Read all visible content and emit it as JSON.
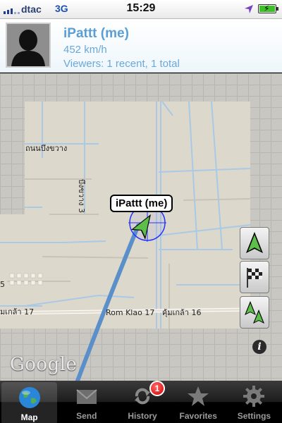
{
  "status_bar": {
    "carrier": "dtac",
    "network": "3G",
    "time": "15:29",
    "icons": [
      "signal-icon",
      "location-arrow-icon",
      "battery-charging-icon"
    ]
  },
  "user": {
    "name": "iPattt (me)",
    "speed": "452 km/h",
    "viewers": "Viewers: 1 recent, 1 total"
  },
  "map": {
    "marker_label": "iPattt (me)",
    "labels": {
      "thanon_bueng_khwang": "ถนนบึงขวาง",
      "bueng_khwang_3": "บึงขวาง 3",
      "rom_klao_17_th": "มเกล้า 17",
      "rom_klao_17_en": "Rom Klao 17",
      "khum_klao_16": "คุ้มเกล้า 16",
      "edge_5": "5"
    },
    "attribution": "Google",
    "controls": [
      "navigation-arrow-icon",
      "checkered-flag-icon",
      "multi-arrow-icon",
      "info-icon"
    ],
    "colors": {
      "road": "#9fc4e4",
      "land": "#ddd8cc",
      "track": "#5a8fc9",
      "arrow": "#5cbf4a"
    }
  },
  "tabs": [
    {
      "label": "Map",
      "icon": "globe-icon",
      "active": true
    },
    {
      "label": "Send",
      "icon": "envelope-icon",
      "active": false
    },
    {
      "label": "History",
      "icon": "refresh-icon",
      "badge": "1",
      "active": false
    },
    {
      "label": "Favorites",
      "icon": "star-icon",
      "active": false
    },
    {
      "label": "Settings",
      "icon": "gear-icon",
      "active": false
    }
  ]
}
